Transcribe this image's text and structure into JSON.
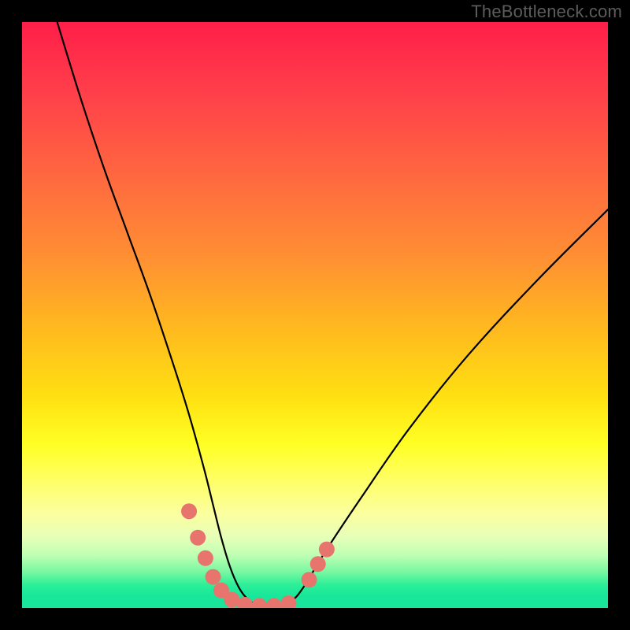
{
  "watermark": "TheBottleneck.com",
  "colors": {
    "page_bg": "#000000",
    "watermark": "#5c5c5c",
    "curve": "#000000",
    "marker_fill": "#e8746e",
    "marker_stroke": "#cf5b55",
    "gradient_stops": [
      "#ff1e49",
      "#ff3f4a",
      "#ff6740",
      "#ff8f33",
      "#ffb81f",
      "#ffe012",
      "#ffff24",
      "#ffff63",
      "#fbffa0",
      "#e6ffb8",
      "#beffb3",
      "#74f7a0",
      "#2def98",
      "#18e69a"
    ]
  },
  "chart_data": {
    "type": "line",
    "title": "",
    "xlabel": "",
    "ylabel": "",
    "xlim": [
      0,
      100
    ],
    "ylim": [
      0,
      100
    ],
    "grid": false,
    "legend": false,
    "series": [
      {
        "name": "curve",
        "x": [
          6,
          10,
          14,
          18,
          22,
          26,
          28.5,
          31,
          32.5,
          34,
          35.5,
          37,
          38.5,
          40,
          42,
          44,
          46,
          48,
          52,
          58,
          66,
          76,
          88,
          100
        ],
        "y": [
          100,
          87,
          75,
          64,
          53,
          41,
          33,
          24,
          18,
          12,
          7,
          3.5,
          1.5,
          0.6,
          0.3,
          0.3,
          1.2,
          3.5,
          10,
          19,
          30.5,
          43,
          56,
          68
        ]
      }
    ],
    "markers": [
      {
        "x": 28.5,
        "y": 16.5
      },
      {
        "x": 30.0,
        "y": 12.0
      },
      {
        "x": 31.3,
        "y": 8.5
      },
      {
        "x": 32.6,
        "y": 5.3
      },
      {
        "x": 34.0,
        "y": 3.0
      },
      {
        "x": 35.8,
        "y": 1.4
      },
      {
        "x": 38.0,
        "y": 0.55
      },
      {
        "x": 40.5,
        "y": 0.35
      },
      {
        "x": 43.0,
        "y": 0.35
      },
      {
        "x": 45.5,
        "y": 0.8
      },
      {
        "x": 49.0,
        "y": 4.8
      },
      {
        "x": 50.5,
        "y": 7.5
      },
      {
        "x": 52.0,
        "y": 10.0
      }
    ],
    "marker_radius_px": 10
  }
}
